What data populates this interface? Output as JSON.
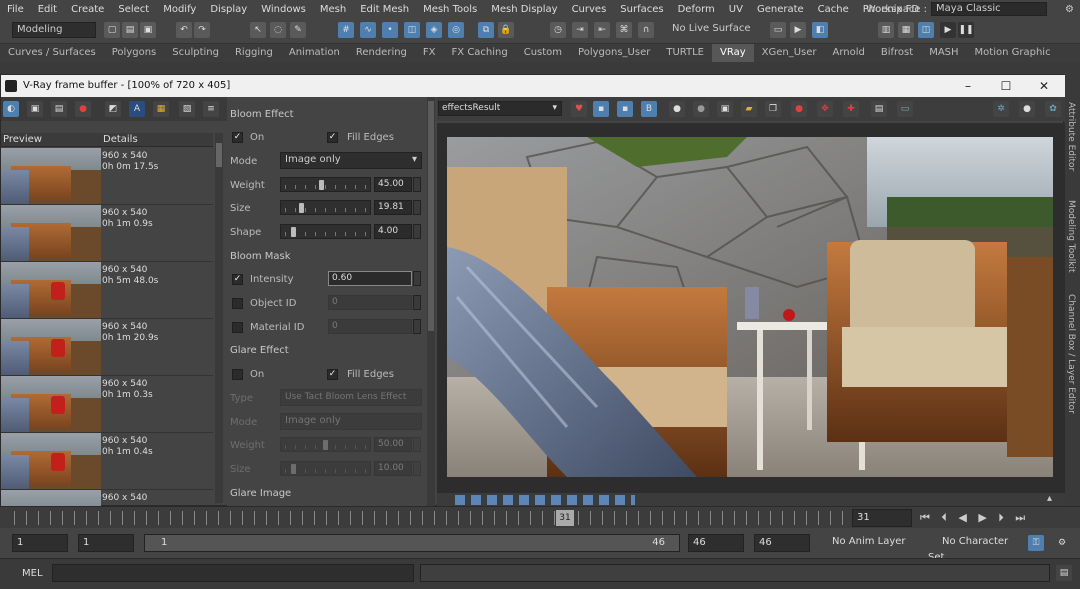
{
  "menubar": {
    "items": [
      "File",
      "Edit",
      "Create",
      "Select",
      "Modify",
      "Display",
      "Windows",
      "Mesh",
      "Edit Mesh",
      "Mesh Tools",
      "Mesh Display",
      "Curves",
      "Surfaces",
      "Deform",
      "UV",
      "Generate",
      "Cache",
      "Phoenix FD",
      "Help"
    ],
    "workspace_label": "Workspace :",
    "workspace_value": "Maya Classic"
  },
  "statusline": {
    "mode": "Modeling",
    "live_surface": "No Live Surface"
  },
  "shelf": {
    "tabs": [
      "Curves / Surfaces",
      "Polygons",
      "Sculpting",
      "Rigging",
      "Animation",
      "Rendering",
      "FX",
      "FX Caching",
      "Custom",
      "Polygons_User",
      "TURTLE",
      "VRay",
      "XGen_User",
      "Arnold",
      "Bifrost",
      "MASH",
      "Motion Graphic"
    ],
    "active": "VRay"
  },
  "vfb": {
    "title": "V-Ray frame buffer - [100% of 720 x 405]",
    "history_headers": [
      "Preview",
      "Details"
    ],
    "history": [
      {
        "size": "960 x 540",
        "time": "0h 0m 17.5s"
      },
      {
        "size": "960 x 540",
        "time": "0h 1m 0.9s"
      },
      {
        "size": "960 x 540",
        "time": "0h 5m 48.0s"
      },
      {
        "size": "960 x 540",
        "time": "0h 1m 20.9s"
      },
      {
        "size": "960 x 540",
        "time": "0h 1m 0.3s"
      },
      {
        "size": "960 x 540",
        "time": "0h 1m 0.4s"
      },
      {
        "size": "960 x 540",
        "time": ""
      }
    ],
    "channel": "effectsResult",
    "bloom": {
      "title": "Bloom Effect",
      "on_label": "On",
      "fill_edges_label": "Fill Edges",
      "mode_label": "Mode",
      "mode_value": "Image only",
      "weight_label": "Weight",
      "weight_value": "45.00",
      "weight_level": 0.45,
      "size_label": "Size",
      "size_value": "19.81",
      "size_level": 0.2,
      "shape_label": "Shape",
      "shape_value": "4.00",
      "shape_level": 0.1
    },
    "bloom_mask": {
      "title": "Bloom Mask",
      "intensity_label": "Intensity",
      "intensity_value": "0.60",
      "object_id_label": "Object ID",
      "object_id_value": "0",
      "material_id_label": "Material ID",
      "material_id_value": "0"
    },
    "glare": {
      "title": "Glare Effect",
      "on_label": "On",
      "fill_edges_label": "Fill Edges",
      "type_label": "Type",
      "type_value": "Use Tact Bloom Lens Effect",
      "mode_label": "Mode",
      "mode_value": "Image only",
      "weight_label": "Weight",
      "weight_value": "50.00",
      "weight_level": 0.5,
      "size_label": "Size",
      "size_value": "10.00",
      "size_level": 0.1
    },
    "glare_image_title": "Glare Image"
  },
  "timeline": {
    "current_frame": "31",
    "current_field": "31"
  },
  "range": {
    "start": "1",
    "start2": "1",
    "slider_start": "1",
    "slider_end": "46",
    "end1": "46",
    "end2": "46",
    "anim_layer": "No Anim Layer",
    "char_set": "No Character Set"
  },
  "cmd": {
    "label": "MEL"
  },
  "side_tabs": [
    "Attribute Editor",
    "Modeling Toolkit",
    "Channel Box / Layer Editor"
  ],
  "colors": {
    "accent": "#4f7fae",
    "panel": "#444444",
    "title_bar": "#f0f0f0"
  }
}
